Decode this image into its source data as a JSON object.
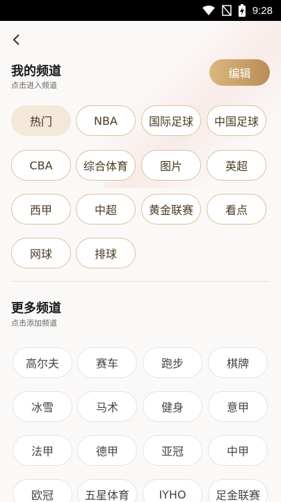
{
  "status_bar": {
    "time": "9:28",
    "icons": [
      "wifi-icon",
      "signal-muted-icon",
      "battery-charging-icon"
    ]
  },
  "header": {
    "back_icon": "chevron-left-icon"
  },
  "my_channels": {
    "title": "我的频道",
    "subtitle": "点击进入频道",
    "edit_label": "编辑",
    "items": [
      {
        "label": "热门",
        "active": true
      },
      {
        "label": "NBA"
      },
      {
        "label": "国际足球"
      },
      {
        "label": "中国足球"
      },
      {
        "label": "CBA"
      },
      {
        "label": "综合体育"
      },
      {
        "label": "图片"
      },
      {
        "label": "英超"
      },
      {
        "label": "西甲"
      },
      {
        "label": "中超"
      },
      {
        "label": "黄金联赛"
      },
      {
        "label": "看点"
      },
      {
        "label": "网球"
      },
      {
        "label": "排球"
      }
    ]
  },
  "more_channels": {
    "title": "更多频道",
    "subtitle": "点击添加频道",
    "items": [
      {
        "label": "高尔夫"
      },
      {
        "label": "赛车"
      },
      {
        "label": "跑步"
      },
      {
        "label": "棋牌"
      },
      {
        "label": "冰雪"
      },
      {
        "label": "马术"
      },
      {
        "label": "健身"
      },
      {
        "label": "意甲"
      },
      {
        "label": "法甲"
      },
      {
        "label": "德甲"
      },
      {
        "label": "亚冠"
      },
      {
        "label": "中甲"
      },
      {
        "label": "欧冠"
      },
      {
        "label": "五星体育"
      },
      {
        "label": "IYHO"
      },
      {
        "label": "足金联赛"
      }
    ]
  }
}
